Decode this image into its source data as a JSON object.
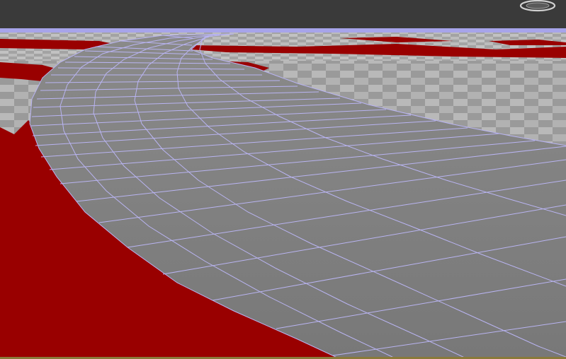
{
  "viewport": {
    "colors": {
      "background_top": "#3a3a3a",
      "ground_light": "#9c9c9c",
      "ground_checker": "#b8b8b8",
      "terrain_red": "#990000",
      "road_surface": "#7e7e7e",
      "wireframe": "#b9b4f2",
      "horizon_band": "#a7a4ea",
      "bottom_strip": "#8a7a3a"
    },
    "icons": {
      "viewcube": "viewcube-ring-icon"
    }
  }
}
